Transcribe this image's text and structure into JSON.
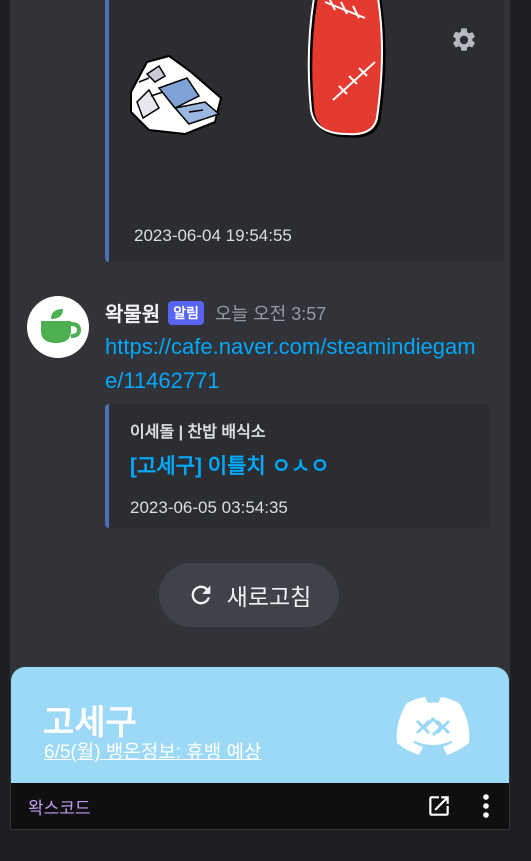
{
  "embed_top": {
    "timestamp": "2023-06-04 19:54:55"
  },
  "message": {
    "author": "왁물원",
    "badge": "알림",
    "time": "오늘 오전 3:57",
    "link": "https://cafe.naver.com/steamindiegame/11462771",
    "embed": {
      "source": "이세돌 | 찬밥 배식소",
      "title": "[고세구] 이틀치 ㅇㅅㅇ",
      "timestamp": "2023-06-05 03:54:35"
    }
  },
  "refresh": {
    "label": "새로고침"
  },
  "banner": {
    "name": "고세구",
    "subtitle": "6/5(월) 뱅온정보: 휴뱅 예상"
  },
  "footer": {
    "brand": "왁스코드"
  },
  "colors": {
    "accent_link": "#00a8fc",
    "badge": "#5865f2",
    "banner": "#9bd9f6",
    "brand_text": "#c39cf2"
  }
}
